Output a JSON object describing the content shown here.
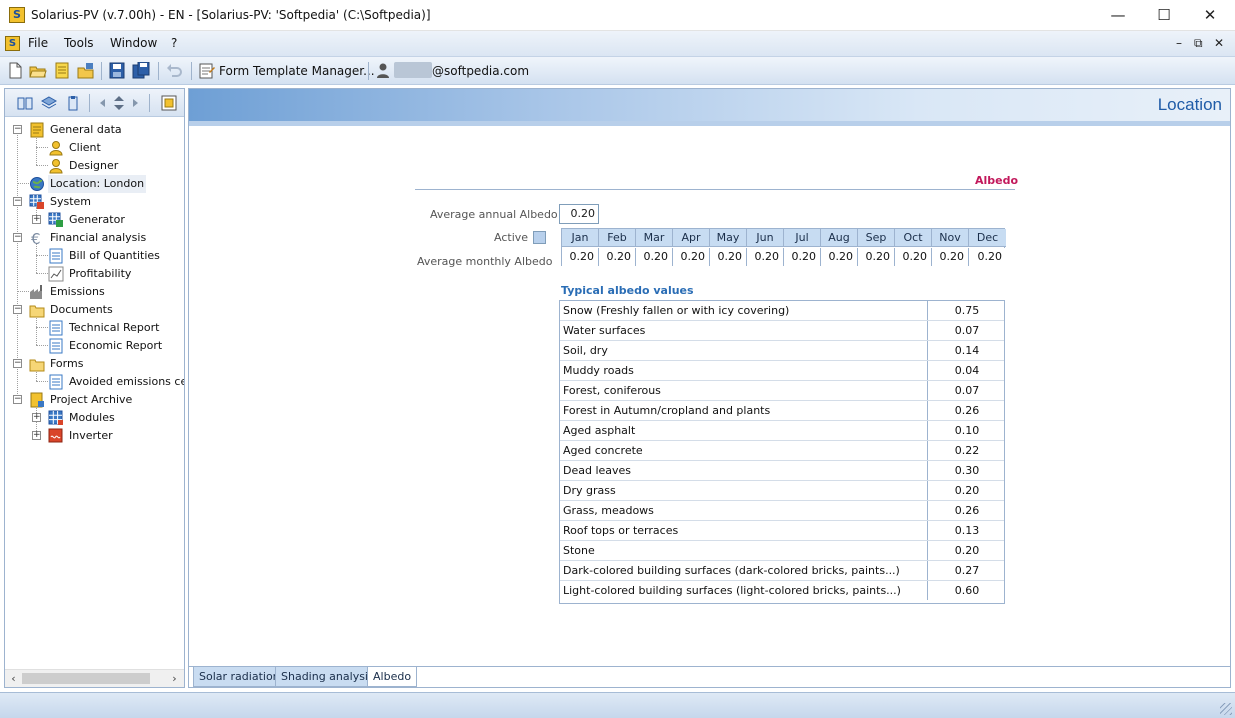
{
  "window": {
    "title": "Solarius-PV (v.7.00h) - EN - [Solarius-PV: 'Softpedia' (C:\\Softpedia)]",
    "app_icon_glyph": "S",
    "minimize_glyph": "—",
    "maximize_glyph": "☐",
    "close_glyph": "✕"
  },
  "menubar": {
    "items": [
      "File",
      "Tools",
      "Window",
      "?"
    ],
    "mdi_minimize": "–",
    "mdi_restore": "⧉",
    "mdi_close": "✕"
  },
  "toolbar": {
    "form_template_label": "Form Template Manager...",
    "user_suffix": "@softpedia.com",
    "icons": [
      "new-icon",
      "open-icon",
      "notes-icon",
      "open-folder-icon",
      "save-icon",
      "save-all-icon",
      "undo-icon",
      "form-template-icon",
      "user-icon"
    ]
  },
  "left_panel": {
    "toolbar_icons": [
      "book-icon",
      "layers-icon",
      "clipboard-icon",
      "nav-left-icon",
      "nav-updown-icon",
      "nav-right-icon",
      "panel-icon"
    ],
    "tree": [
      {
        "label": "General data",
        "icon": "folder-doc-icon",
        "level": 0,
        "expander": "−"
      },
      {
        "label": "Client",
        "icon": "person-icon",
        "level": 1
      },
      {
        "label": "Designer",
        "icon": "person-icon",
        "level": 1
      },
      {
        "label": "Location: London",
        "icon": "globe-icon",
        "level": 0,
        "selected": true
      },
      {
        "label": "System",
        "icon": "system-icon",
        "level": 0,
        "expander": "−"
      },
      {
        "label": "Generator",
        "icon": "generator-icon",
        "level": 1,
        "expander": "+"
      },
      {
        "label": "Financial analysis",
        "icon": "euro-icon",
        "level": 0,
        "expander": "−"
      },
      {
        "label": "Bill of Quantities",
        "icon": "document-icon",
        "level": 1
      },
      {
        "label": "Profitability",
        "icon": "chart-icon",
        "level": 1
      },
      {
        "label": "Emissions",
        "icon": "factory-icon",
        "level": 0
      },
      {
        "label": "Documents",
        "icon": "folder-icon",
        "level": 0,
        "expander": "−"
      },
      {
        "label": "Technical Report",
        "icon": "document-icon",
        "level": 1
      },
      {
        "label": "Economic Report",
        "icon": "document-icon",
        "level": 1
      },
      {
        "label": "Forms",
        "icon": "folder-icon",
        "level": 0,
        "expander": "−"
      },
      {
        "label": "Avoided emissions certif",
        "icon": "document-icon",
        "level": 1
      },
      {
        "label": "Project Archive",
        "icon": "archive-icon",
        "level": 0,
        "expander": "−"
      },
      {
        "label": "Modules",
        "icon": "module-icon",
        "level": 1,
        "expander": "+"
      },
      {
        "label": "Inverter",
        "icon": "inverter-icon",
        "level": 1,
        "expander": "+"
      }
    ]
  },
  "main": {
    "header_title": "Location",
    "section_title": "Albedo",
    "average_annual_label": "Average annual Albedo",
    "average_annual_value": "0.20",
    "active_label": "Active",
    "average_monthly_label": "Average monthly Albedo",
    "months": [
      "Jan",
      "Feb",
      "Mar",
      "Apr",
      "May",
      "Jun",
      "Jul",
      "Aug",
      "Sep",
      "Oct",
      "Nov",
      "Dec"
    ],
    "monthly_values": [
      "0.20",
      "0.20",
      "0.20",
      "0.20",
      "0.20",
      "0.20",
      "0.20",
      "0.20",
      "0.20",
      "0.20",
      "0.20",
      "0.20"
    ],
    "typical_title": "Typical albedo values",
    "typical_values": [
      {
        "surface": "Snow (Freshly fallen or with icy covering)",
        "value": "0.75"
      },
      {
        "surface": "Water surfaces",
        "value": "0.07"
      },
      {
        "surface": "Soil, dry",
        "value": "0.14"
      },
      {
        "surface": "Muddy roads",
        "value": "0.04"
      },
      {
        "surface": "Forest, coniferous",
        "value": "0.07"
      },
      {
        "surface": "Forest in Autumn/cropland and plants",
        "value": "0.26"
      },
      {
        "surface": "Aged asphalt",
        "value": "0.10"
      },
      {
        "surface": "Aged concrete",
        "value": "0.22"
      },
      {
        "surface": "Dead leaves",
        "value": "0.30"
      },
      {
        "surface": "Dry grass",
        "value": "0.20"
      },
      {
        "surface": "Grass, meadows",
        "value": "0.26"
      },
      {
        "surface": "Roof tops or terraces",
        "value": "0.13"
      },
      {
        "surface": "Stone",
        "value": "0.20"
      },
      {
        "surface": "Dark-colored building surfaces (dark-colored bricks, paints...)",
        "value": "0.27"
      },
      {
        "surface": "Light-colored building surfaces (light-colored bricks, paints...)",
        "value": "0.60"
      }
    ],
    "tabs": [
      {
        "label": "Solar radiation",
        "active": false
      },
      {
        "label": "Shading analysis",
        "active": false
      },
      {
        "label": "Albedo",
        "active": true
      }
    ]
  },
  "colors": {
    "accent": "#1f5ca8",
    "section_title": "#c2185b",
    "typical_title": "#2a6db5",
    "month_header": "#c7dcf2"
  }
}
